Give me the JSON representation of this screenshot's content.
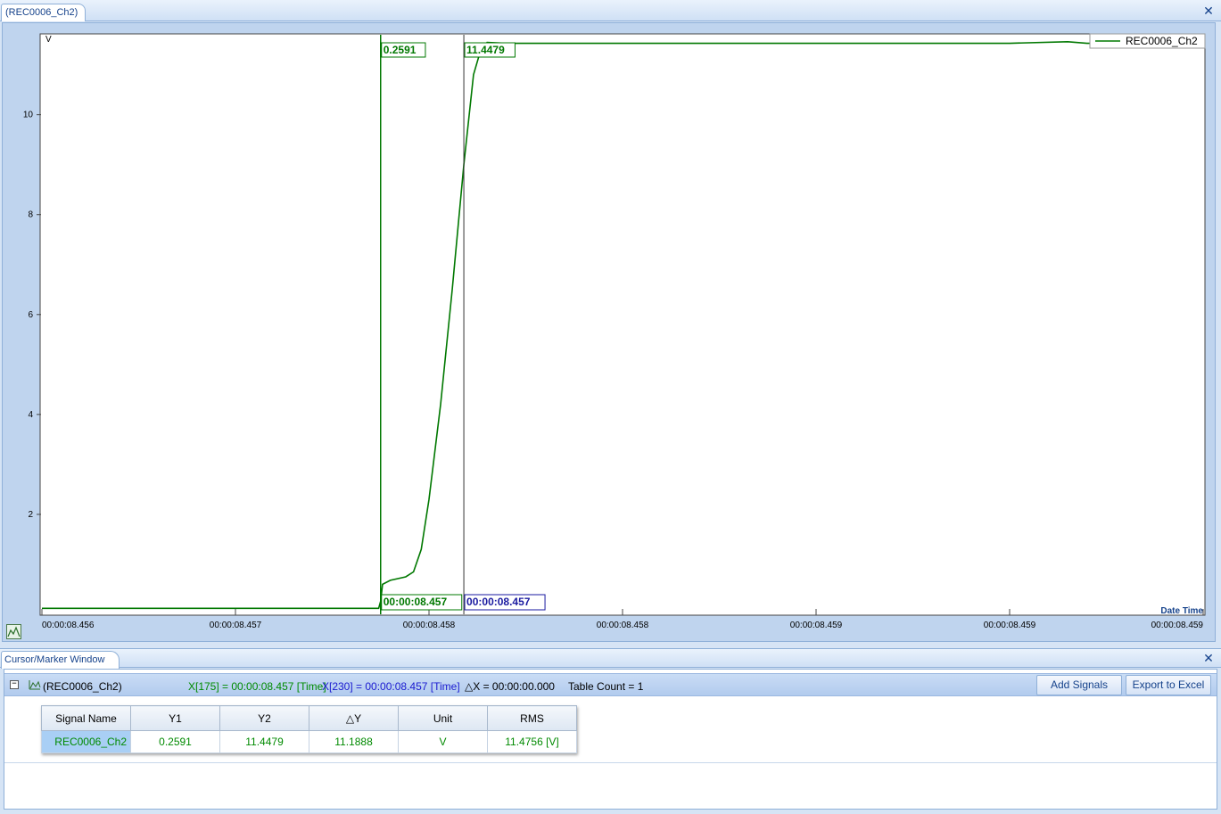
{
  "document_tab": {
    "label": "(REC0006_Ch2)"
  },
  "chart_data": {
    "type": "line",
    "title": "",
    "xlabel": "Date Time",
    "ylabel": "V",
    "ylim": [
      0,
      11.6
    ],
    "y_ticks": [
      2,
      4,
      6,
      8,
      10
    ],
    "x_tick_labels": [
      "00:00:08.456",
      "00:00:08.457",
      "00:00:08.458",
      "00:00:08.458",
      "00:00:08.459",
      "00:00:08.459",
      "00:00:08.459"
    ],
    "x_range_samples": [
      0,
      600
    ],
    "series": [
      {
        "name": "REC0006_Ch2",
        "color": "#007800",
        "x": [
          0,
          165,
          174,
          175,
          176,
          180,
          188,
          192,
          196,
          200,
          206,
          212,
          218,
          223,
          226,
          228,
          230,
          240,
          300,
          400,
          500,
          530,
          540,
          560,
          600
        ],
        "y": [
          0.12,
          0.12,
          0.12,
          0.2591,
          0.6,
          0.68,
          0.75,
          0.85,
          1.3,
          2.3,
          4.2,
          6.5,
          9.0,
          10.8,
          11.2,
          11.35,
          11.4479,
          11.43,
          11.43,
          11.43,
          11.43,
          11.46,
          11.43,
          11.43,
          11.43
        ]
      }
    ],
    "cursors": [
      {
        "id": "cursor-1",
        "sample": 175,
        "color": "#007800",
        "value_label": "0.2591",
        "time_label": "00:00:08.457"
      },
      {
        "id": "cursor-2",
        "sample": 218,
        "color": "#1a1aa0",
        "value_label": "11.4479",
        "time_label": "00:00:08.457"
      }
    ],
    "legend": {
      "position": "top-right",
      "entries": [
        "REC0006_Ch2"
      ]
    },
    "grid": false
  },
  "cursor_window": {
    "tab_label": "Cursor/Marker Window",
    "signal_group": "(REC0006_Ch2)",
    "x1_text": "X[175] = 00:00:08.457 [Time]",
    "x2_text": "X[230] = 00:00:08.457 [Time]",
    "delta_x_text": "△X = 00:00:00.000",
    "table_count_text": "Table Count = 1",
    "add_signals_label": "Add Signals",
    "export_label": "Export to Excel",
    "table": {
      "headers": [
        "Signal Name",
        "Y1",
        "Y2",
        "△Y",
        "Unit",
        "RMS"
      ],
      "rows": [
        [
          "REC0006_Ch2",
          "0.2591",
          "11.4479",
          "11.1888",
          "V",
          "11.4756 [V]"
        ]
      ]
    },
    "colors": {
      "x1": "#008a00",
      "x2": "#1a1ad0",
      "values": "#008a00"
    }
  }
}
